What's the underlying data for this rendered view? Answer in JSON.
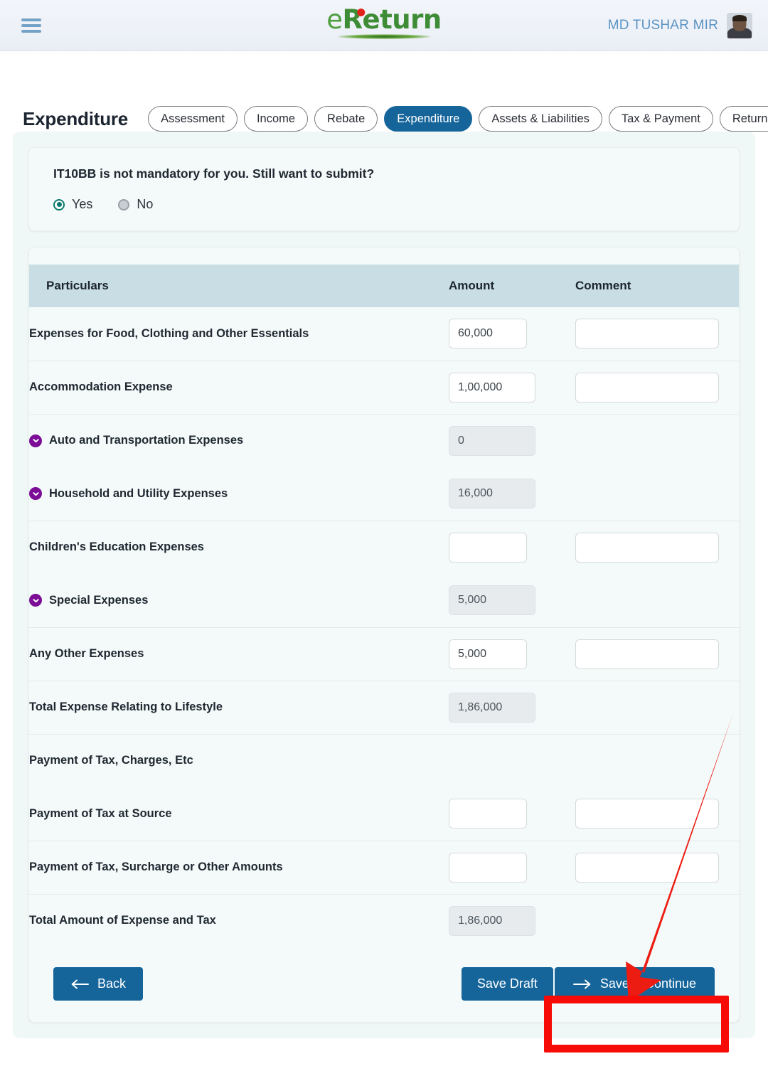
{
  "header": {
    "menu_icon": "hamburger-icon",
    "logo_text_a": "e",
    "logo_text_b": "Return",
    "user_name": "MD TUSHAR MIR",
    "avatar_icon": "user-avatar"
  },
  "page": {
    "title": "Expenditure"
  },
  "tabs": [
    {
      "label": "Assessment",
      "active": false
    },
    {
      "label": "Income",
      "active": false
    },
    {
      "label": "Rebate",
      "active": false
    },
    {
      "label": "Expenditure",
      "active": true
    },
    {
      "label": "Assets & Liabilities",
      "active": false
    },
    {
      "label": "Tax & Payment",
      "active": false
    },
    {
      "label": "Return View",
      "active": false
    }
  ],
  "mandatory_card": {
    "question": "IT10BB is not mandatory for you. Still want to submit?",
    "options": [
      {
        "label": "Yes",
        "selected": true
      },
      {
        "label": "No",
        "selected": false
      }
    ]
  },
  "table": {
    "headers": {
      "particulars": "Particulars",
      "amount": "Amount",
      "comment": "Comment"
    },
    "rows": [
      {
        "label": "Expenses for Food, Clothing and Other Essentials",
        "amount": "60,000",
        "comment": "",
        "expandable": false,
        "readonly": false,
        "has_comment": true,
        "divider": true
      },
      {
        "label": "Accommodation Expense",
        "amount": "1,00,000",
        "comment": "",
        "expandable": false,
        "readonly": false,
        "has_comment": true,
        "divider": true
      },
      {
        "label": "Auto and Transportation Expenses",
        "amount": "0",
        "comment": "",
        "expandable": true,
        "readonly": true,
        "has_comment": false,
        "divider": false
      },
      {
        "label": "Household and Utility Expenses",
        "amount": "16,000",
        "comment": "",
        "expandable": true,
        "readonly": true,
        "has_comment": false,
        "divider": true
      },
      {
        "label": "Children's Education Expenses",
        "amount": "",
        "comment": "",
        "expandable": false,
        "readonly": false,
        "has_comment": true,
        "divider": false
      },
      {
        "label": "Special Expenses",
        "amount": "5,000",
        "comment": "",
        "expandable": true,
        "readonly": true,
        "has_comment": false,
        "divider": true
      },
      {
        "label": "Any Other Expenses",
        "amount": "5,000",
        "comment": "",
        "expandable": false,
        "readonly": false,
        "has_comment": true,
        "divider": true
      },
      {
        "label": "Total Expense Relating to Lifestyle",
        "amount": "1,86,000",
        "comment": "",
        "expandable": false,
        "readonly": true,
        "has_comment": false,
        "divider": true
      },
      {
        "label": "Payment of Tax, Charges, Etc",
        "amount": null,
        "comment": "",
        "expandable": false,
        "readonly": false,
        "has_comment": false,
        "divider": false,
        "section": true
      },
      {
        "label": "Payment of Tax at Source",
        "amount": "",
        "comment": "",
        "expandable": false,
        "readonly": false,
        "has_comment": true,
        "divider": true
      },
      {
        "label": "Payment of Tax, Surcharge or Other Amounts",
        "amount": "",
        "comment": "",
        "expandable": false,
        "readonly": false,
        "has_comment": true,
        "divider": true
      },
      {
        "label": "Total Amount of Expense and Tax",
        "amount": "1,86,000",
        "comment": "",
        "expandable": false,
        "readonly": true,
        "has_comment": false,
        "divider": false
      }
    ]
  },
  "footer": {
    "back_label": "Back",
    "save_draft_label": "Save Draft",
    "save_continue_label": "Save & Continue"
  },
  "annotation": {
    "highlight_color": "#f60b06",
    "target": "save-continue-button"
  }
}
